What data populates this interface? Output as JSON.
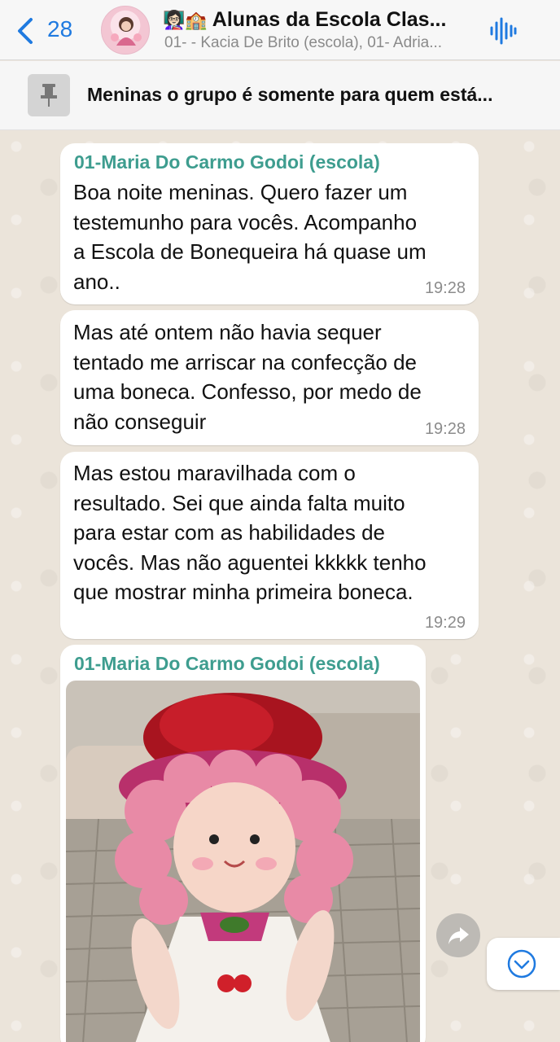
{
  "header": {
    "back_count": "28",
    "title_emoji": "👩🏻‍🏫🏫",
    "title": "Alunas da Escola Clas...",
    "subtitle": "01- - Kacia De Brito (escola), 01- Adria..."
  },
  "pinned": {
    "text": "Meninas o grupo é somente para quem está..."
  },
  "messages": [
    {
      "sender": "01-Maria Do Carmo Godoi (escola)",
      "lines": [
        "Boa noite meninas. Quero fazer um",
        "testemunho para vocês. Acompanho",
        "a Escola de Bonequeira há quase um",
        "ano.."
      ],
      "time": "19:28"
    },
    {
      "lines": [
        "Mas até ontem não havia sequer",
        "tentado me arriscar na confecção de",
        "uma boneca. Confesso, por medo de",
        "não conseguir"
      ],
      "time": "19:28"
    },
    {
      "lines": [
        "Mas estou maravilhada com o",
        "resultado. Sei que ainda falta muito",
        "para estar com as habilidades de",
        "vocês. Mas não aguentei kkkkk tenho",
        "que mostrar minha primeira boneca."
      ],
      "time": "19:29"
    },
    {
      "sender": "01-Maria Do Carmo Godoi (escola)",
      "image": "rag-doll-photo"
    }
  ],
  "colors": {
    "accent_blue": "#1f7ae0",
    "sender_green": "#3e9d8f",
    "wallpaper": "#ebe4da"
  },
  "icons": [
    "chevron-left-icon",
    "audio-waveform-icon",
    "pin-icon",
    "forward-icon",
    "chevron-down-icon"
  ]
}
